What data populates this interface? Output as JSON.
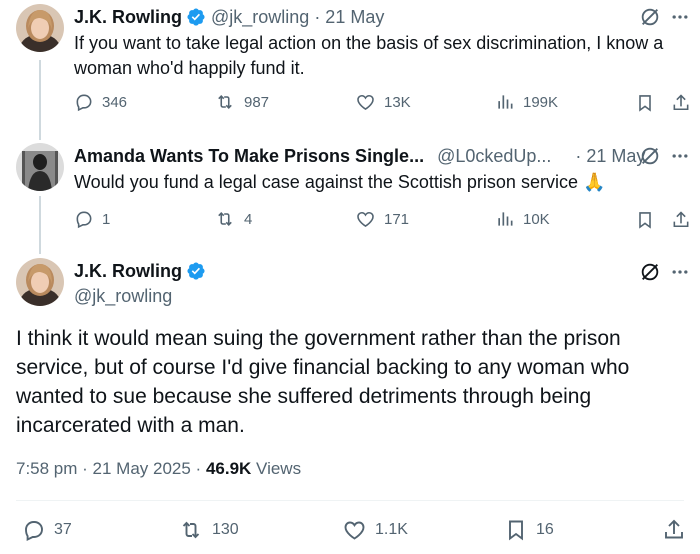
{
  "tweet1": {
    "name": "J.K. Rowling",
    "handle": "@jk_rowling",
    "date": "· 21 May",
    "text": "If you want to take legal action on the basis of sex discrimination, I know a woman who'd happily fund it.",
    "replies": "346",
    "retweets": "987",
    "likes": "13K",
    "views": "199K"
  },
  "tweet2": {
    "name": "Amanda Wants To Make Prisons Single...",
    "handle": "@L0ckedUp...",
    "date": "· 21 May",
    "text": "Would you fund a legal case against the Scottish prison service",
    "emoji": "🙏",
    "replies": "1",
    "retweets": "4",
    "likes": "171",
    "views": "10K"
  },
  "main_tweet": {
    "name": "J.K. Rowling",
    "handle": "@jk_rowling",
    "text": "I think it would mean suing the government rather than the prison service, but of course I'd give financial backing to any woman who wanted to sue because she suffered detriments through being incarcerated with a man.",
    "time": "7:58 pm · 21 May 2025 · ",
    "views_count": "46.9K",
    "views_label": " Views",
    "replies": "37",
    "retweets": "130",
    "likes": "1.1K",
    "bookmarks": "16"
  },
  "colors": {
    "verified": "#1d9bf0",
    "text": "#0f1419",
    "secondary": "#536471",
    "thread_line": "#cfd9de"
  }
}
